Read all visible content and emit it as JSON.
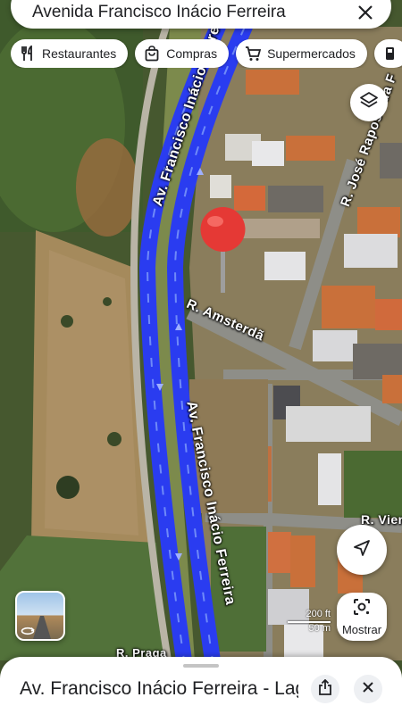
{
  "search": {
    "query": "Avenida Francisco Inácio Ferreira"
  },
  "chips": [
    {
      "label": "Restaurantes",
      "icon": "fork-knife-icon"
    },
    {
      "label": "Compras",
      "icon": "shopping-bag-icon"
    },
    {
      "label": "Supermercados",
      "icon": "shopping-cart-icon"
    }
  ],
  "map": {
    "streets": {
      "avenue_top": "Av. Francisco Inácio Ferreira",
      "avenue_bottom": "Av. Francisco Inácio Ferreira",
      "amsterda": "R. Amsterdã",
      "jose_raposo": "R. José Raposo da F",
      "viena": "R. Vien",
      "praga": "R. Praga"
    },
    "colors": {
      "route": "#2a3cf0",
      "pin": "#e53935"
    }
  },
  "scale": {
    "feet": "200 ft",
    "meters": "50 m"
  },
  "buttons": {
    "lens_label": "Mostrar"
  },
  "sheet": {
    "title": "Av. Francisco Inácio Ferreira - Lagoa Santa"
  }
}
